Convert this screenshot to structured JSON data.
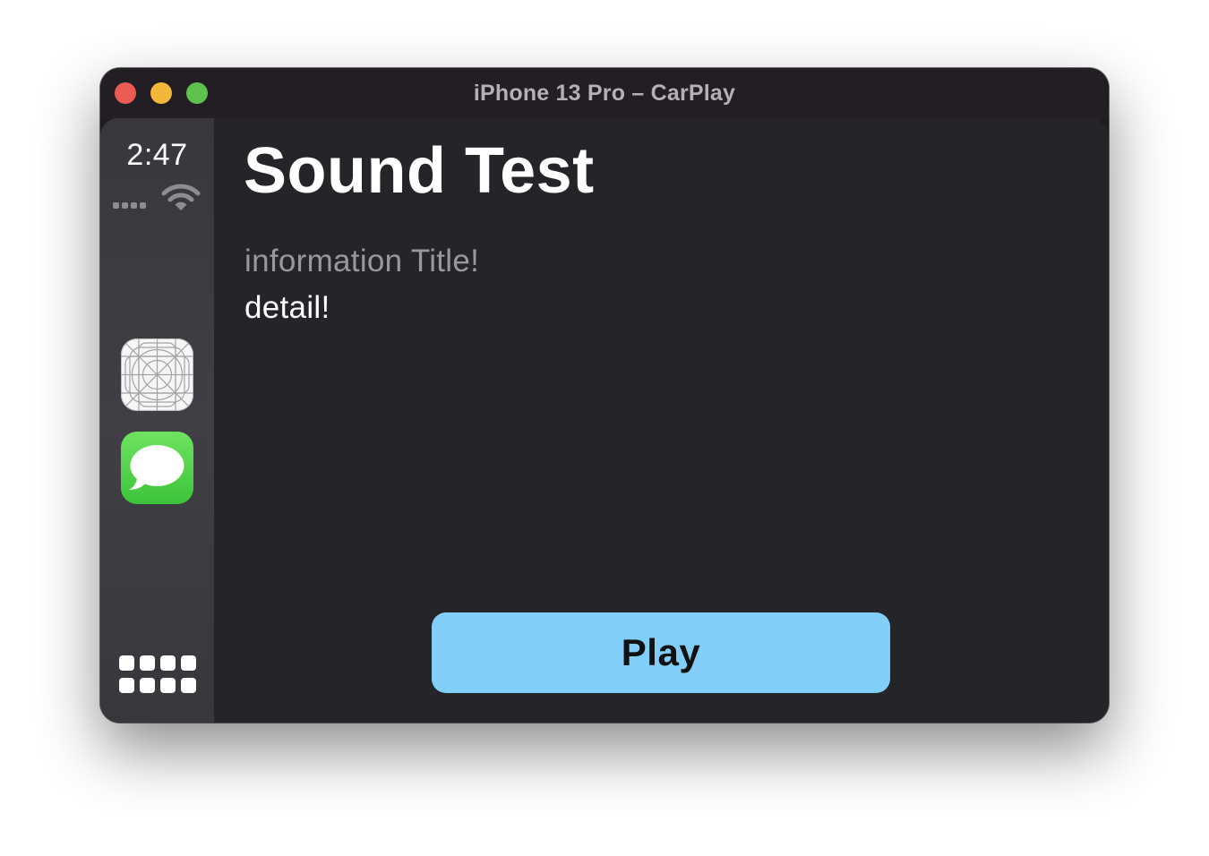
{
  "window": {
    "title": "iPhone 13 Pro – CarPlay"
  },
  "status": {
    "time": "2:47",
    "signal_icon": "cellular-signal-icon",
    "wifi_icon": "wifi-icon"
  },
  "sidebar": {
    "apps": [
      {
        "name": "placeholder-app-icon"
      },
      {
        "name": "messages-app-icon"
      }
    ],
    "home_icon": "app-grid-icon"
  },
  "content": {
    "title": "Sound Test",
    "info_title": "information Title!",
    "info_detail": "detail!",
    "play_button_label": "Play"
  },
  "colors": {
    "button": "#81cff8",
    "background": "#252429",
    "sidebar": "#3d3c41"
  }
}
